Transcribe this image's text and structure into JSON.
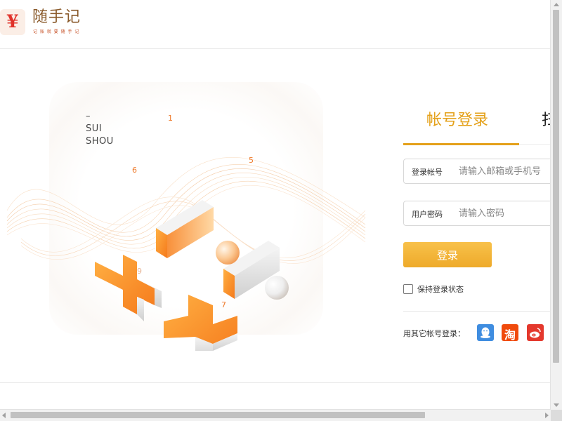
{
  "header": {
    "logo_symbol": "¥",
    "logo_title": "随手记",
    "logo_slogan": "记 账 就 要 随 手 记"
  },
  "hero": {
    "brand_dash": "–",
    "brand_line1": "SUI",
    "brand_line2": "SHOU",
    "numbers": [
      "1",
      "5",
      "6",
      "9",
      "7"
    ],
    "icons": [
      "minus-block-icon",
      "minus-block-icon",
      "plus-block-icon",
      "plus-block-icon",
      "sphere-icon",
      "sphere-icon"
    ]
  },
  "login": {
    "tab_account": "帐号登录",
    "tab_other_partial": "扫",
    "account_label": "登录帐号",
    "account_placeholder": "请输入邮箱或手机号",
    "password_label": "用户密码",
    "password_placeholder": "请输入密码",
    "submit_label": "登录",
    "remember_label": "保持登录状态",
    "other_login_label": "用其它帐号登录：",
    "social": [
      "qq-icon",
      "taobao-icon",
      "weibo-icon"
    ],
    "social_taobao_char": "淘"
  },
  "colors": {
    "accent": "#e4a11a",
    "button": "#f3b438",
    "qq": "#3f8de0",
    "taobao": "#f04a0c",
    "weibo": "#e4382d",
    "logo_red": "#e0322a",
    "number_orange": "#ee7a2a"
  }
}
